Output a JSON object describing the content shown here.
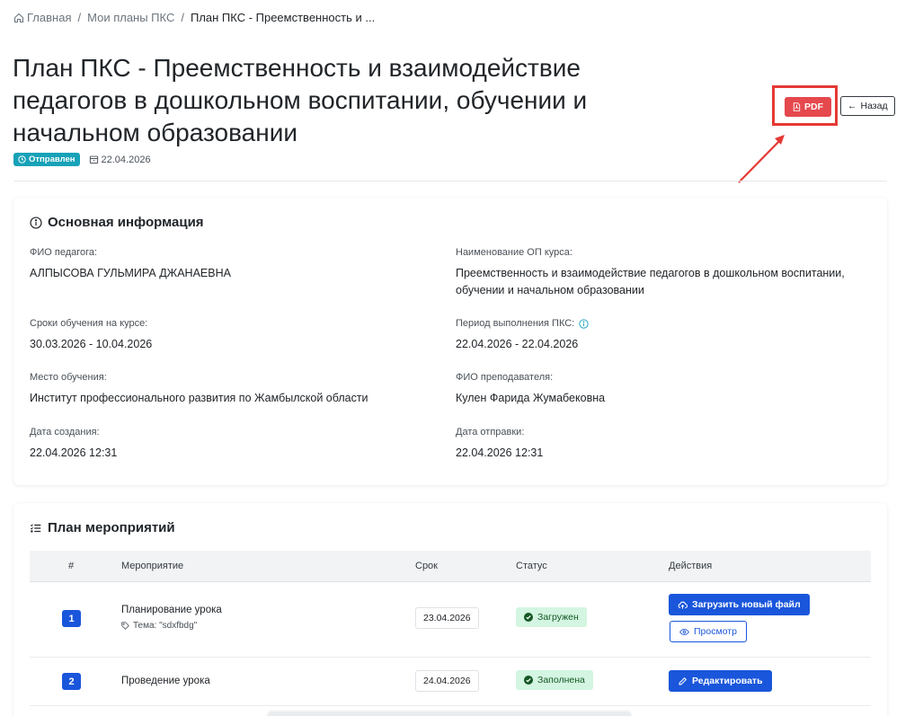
{
  "breadcrumb": {
    "home": "Главная",
    "plans": "Мои планы ПКС",
    "current": "План ПКС - Преемственность и ..."
  },
  "page": {
    "title": "План ПКС - Преемственность и взаимодействие педагогов в дошкольном воспитании, обучении и начальном образовании",
    "status": "Отправлен",
    "date": "22.04.2026"
  },
  "header_actions": {
    "pdf_label": "PDF",
    "back_label": "Назад"
  },
  "info": {
    "title": "Основная информация",
    "teacher_label": "ФИО педагога:",
    "teacher_value": "АЛПЫСОВА ГУЛЬМИРА ДЖАНАЕВНА",
    "course_label": "Наименование ОП курса:",
    "course_value": "Преемственность и взаимодействие педагогов в дошкольном воспитании, обучении и начальном образовании",
    "study_period_label": "Сроки обучения на курсе:",
    "study_period_value": "30.03.2026 - 10.04.2026",
    "pks_period_label": "Период выполнения ПКС:",
    "pks_period_value": "22.04.2026 - 22.04.2026",
    "place_label": "Место обучения:",
    "place_value": "Институт профессионального развития по Жамбылской области",
    "instructor_label": "ФИО преподавателя:",
    "instructor_value": "Кулен Фарида Жумабековна",
    "created_label": "Дата создания:",
    "created_value": "22.04.2026 12:31",
    "sent_label": "Дата отправки:",
    "sent_value": "22.04.2026 12:31"
  },
  "plan": {
    "title": "План мероприятий",
    "columns": [
      "#",
      "Мероприятие",
      "Срок",
      "Статус",
      "Действия"
    ],
    "rows": [
      {
        "num": "1",
        "activity": "Планирование урока",
        "topic": "Тема: \"sdxfbdg\"",
        "deadline": "23.04.2026",
        "status": "Загружен",
        "action_primary": "Загрузить новый файл",
        "action_secondary": "Просмотр"
      },
      {
        "num": "2",
        "activity": "Проведение урока",
        "deadline": "24.04.2026",
        "status": "Заполнена",
        "action_primary": "Редактировать"
      }
    ]
  },
  "colors": {
    "primary": "#1a56db",
    "pdf": "#e5484d",
    "status_sent": "#17a2b8",
    "status_ok_bg": "#d3f5e1",
    "annotation": "#e53935"
  }
}
